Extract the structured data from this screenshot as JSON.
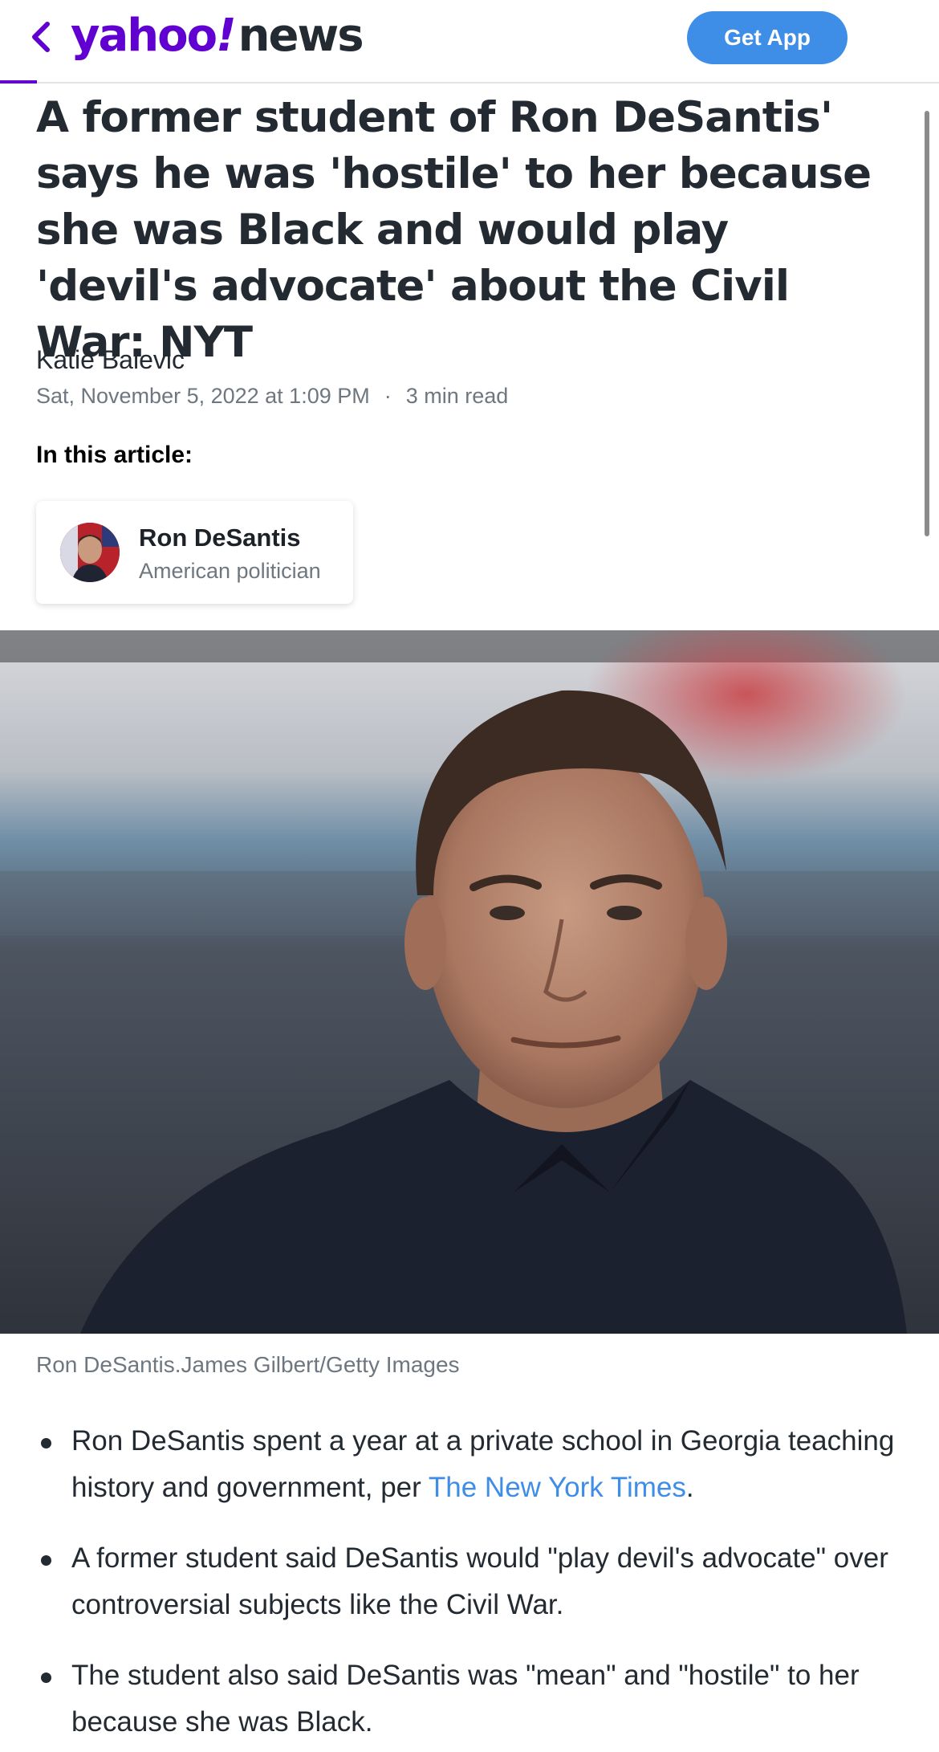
{
  "header": {
    "back_icon": "chevron-left-icon",
    "logo_yahoo": "yahoo",
    "logo_bang": "!",
    "logo_news": "news",
    "get_app_label": "Get App",
    "accent_color": "#6001d2",
    "button_color": "#3e8ee8"
  },
  "article": {
    "headline": "A former student of Ron DeSantis' says he was 'hostile' to her because she was Black and would play 'devil's advocate' about the Civil War: NYT",
    "author": "Katie Balevic",
    "date": "Sat, November 5, 2022 at 1:09 PM",
    "separator": "·",
    "read_time": "3 min read",
    "in_this_article_label": "In this article:",
    "entity": {
      "name": "Ron DeSantis",
      "description": "American politician"
    },
    "photo_caption": "Ron DeSantis.James Gilbert/Getty Images",
    "bullets": [
      {
        "text_before": "Ron DeSantis spent a year at a private school in Georgia teaching history and government, per ",
        "link": "The New York Times",
        "text_after": "."
      },
      {
        "text_before": "A former student said DeSantis would \"play devil's advocate\" over controversial subjects like the Civil War.",
        "link": "",
        "text_after": ""
      },
      {
        "text_before": "The student also said DeSantis was \"mean\" and \"hostile\" to her because she was Black.",
        "link": "",
        "text_after": ""
      }
    ]
  }
}
